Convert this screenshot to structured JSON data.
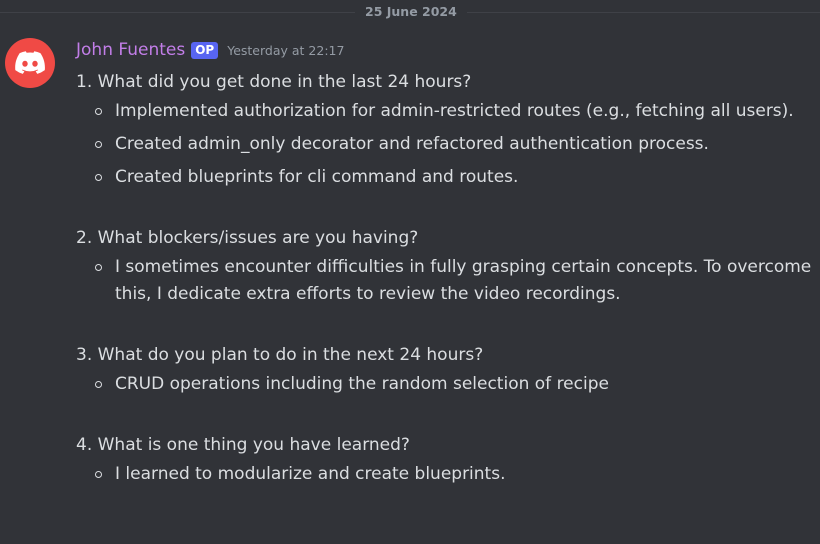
{
  "date_divider": "25 June 2024",
  "message": {
    "author": "John Fuentes",
    "badge": "OP",
    "timestamp": "Yesterday at 22:17",
    "author_color": "#c27ee8",
    "avatar_color": "#f04a45",
    "avatar_icon": "discord-logo-icon"
  },
  "sections": [
    {
      "question": "1. What did you get done in the last 24 hours?",
      "bullets": [
        "Implemented authorization for admin-restricted routes (e.g., fetching all users).",
        "Created admin_only decorator and refactored authentication process.",
        "Created blueprints for cli command and routes."
      ]
    },
    {
      "question": "2. What blockers/issues are you having?",
      "bullets": [
        "I sometimes encounter difficulties in fully grasping certain concepts.  To overcome this, I dedicate extra efforts to review the video recordings."
      ]
    },
    {
      "question": "3. What do you plan to do in the next 24 hours?",
      "bullets": [
        "CRUD operations including the random selection of recipe"
      ]
    },
    {
      "question": "4. What is one thing you have learned?",
      "bullets": [
        "I learned to modularize and create blueprints."
      ]
    }
  ]
}
